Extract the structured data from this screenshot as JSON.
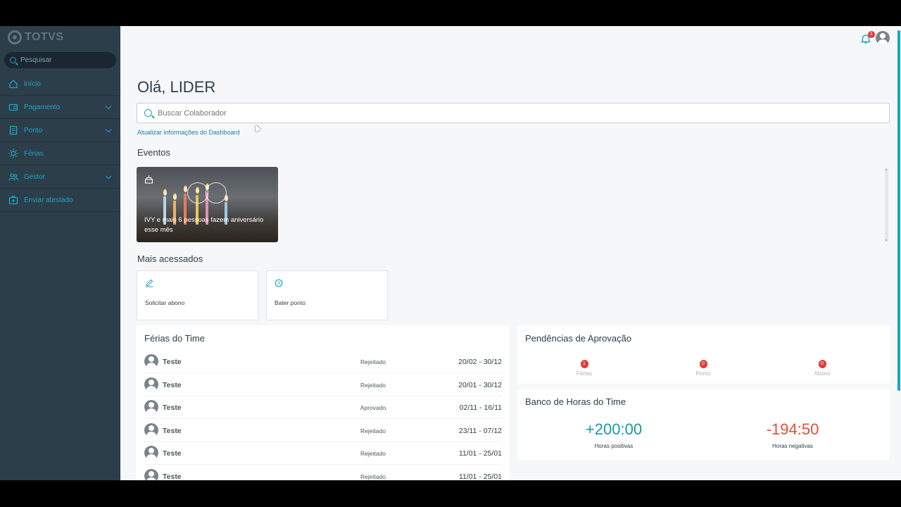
{
  "app": {
    "brand": "TOTVS"
  },
  "sidebar": {
    "search_placeholder": "Pesquisar",
    "items": [
      {
        "label": "Início",
        "icon": "home-icon",
        "has_submenu": false
      },
      {
        "label": "Pagamento",
        "icon": "wallet-icon",
        "has_submenu": true
      },
      {
        "label": "Ponto",
        "icon": "document-icon",
        "has_submenu": true
      },
      {
        "label": "Férias",
        "icon": "sun-icon",
        "has_submenu": false
      },
      {
        "label": "Gestor",
        "icon": "people-icon",
        "has_submenu": true
      },
      {
        "label": "Enviar atestado",
        "icon": "medical-case-icon",
        "has_submenu": false
      }
    ]
  },
  "header": {
    "notification_count": "1"
  },
  "main": {
    "greeting": "Olá, LIDER",
    "collaborator_search_placeholder": "Buscar Colaborador",
    "update_link": "Atualizar informações do Dashboard",
    "events": {
      "title": "Eventos",
      "card_text": "IVY e mais 6 pessoas fazem aniversário esse mês"
    },
    "most_accessed": {
      "title": "Mais acessados",
      "items": [
        {
          "label": "Solicitar abono",
          "icon": "pencil-icon"
        },
        {
          "label": "Bater ponto",
          "icon": "clock-icon"
        }
      ]
    },
    "team_vacation": {
      "title": "Férias do Time",
      "rows": [
        {
          "name": "Teste",
          "status": "Rejeitado",
          "dates": "20/02 - 30/12"
        },
        {
          "name": "Teste",
          "status": "Rejeitado",
          "dates": "20/01 - 30/12"
        },
        {
          "name": "Teste",
          "status": "Aprovado",
          "dates": "02/11 - 16/11"
        },
        {
          "name": "Teste",
          "status": "Rejeitado",
          "dates": "23/11 - 07/12"
        },
        {
          "name": "Teste",
          "status": "Rejeitado",
          "dates": "11/01 - 25/01"
        },
        {
          "name": "Teste",
          "status": "Rejeitado",
          "dates": "11/01 - 25/01"
        }
      ]
    },
    "pending_approvals": {
      "title": "Pendências de Aprovação",
      "items": [
        {
          "label": "Férias",
          "count": "1"
        },
        {
          "label": "Ponto",
          "count": "0"
        },
        {
          "label": "Abono",
          "count": "0"
        }
      ]
    },
    "team_hours_bank": {
      "title": "Banco de Horas do Time",
      "positive": {
        "value": "+200:00",
        "label": "Horas positivas",
        "color": "#1a9a9e"
      },
      "negative": {
        "value": "-194:50",
        "label": "Horas negativas",
        "color": "#e0503c"
      }
    }
  },
  "colors": {
    "sidebar_bg": "#2c3e4a",
    "accent": "#1fa3c4",
    "badge": "#e53935"
  }
}
